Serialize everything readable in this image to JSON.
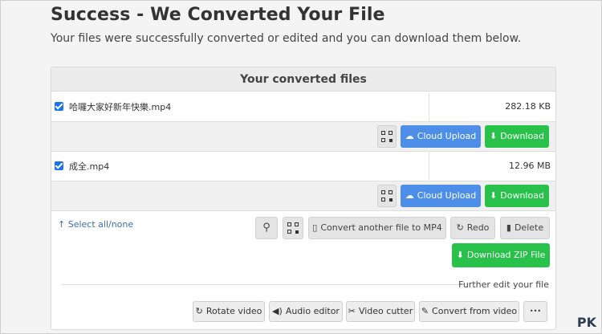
{
  "header": {
    "title": "Success - We Converted Your File",
    "subtitle": "Your files were successfully converted or edited and you can download them below."
  },
  "panel": {
    "title": "Your converted files"
  },
  "files": [
    {
      "name": "哈囉大家好新年快樂.mp4",
      "size": "282.18 KB"
    },
    {
      "name": "成全.mp4",
      "size": "12.96 MB"
    }
  ],
  "file_actions": {
    "cloud_upload": "Cloud Upload",
    "download": "Download"
  },
  "toolbar": {
    "select_all": "Select all/none",
    "convert_another": "Convert another file to MP4",
    "redo": "Redo",
    "delete": "Delete",
    "download_zip": "Download ZIP File"
  },
  "further_edit": {
    "label": "Further edit your file",
    "rotate": "Rotate video",
    "audio": "Audio editor",
    "cutter": "Video cutter",
    "convert_from": "Convert from video",
    "more": "•••"
  },
  "colors": {
    "cloud_upload": "#4d8fe8",
    "download": "#28c24a"
  }
}
